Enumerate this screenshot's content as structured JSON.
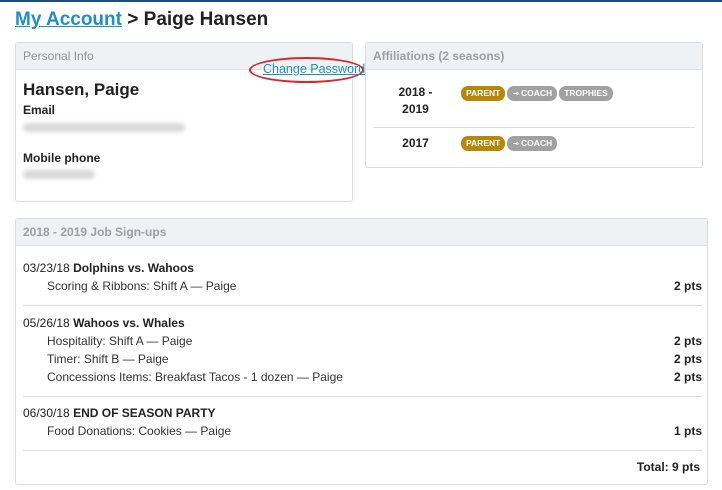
{
  "header": {
    "my_account_link": "My Account",
    "separator": ">",
    "person": "Paige Hansen"
  },
  "personal_info": {
    "heading": "Personal Info",
    "change_password_link": "Change Password",
    "name": "Hansen, Paige",
    "email_label": "Email",
    "mobile_label": "Mobile phone"
  },
  "affiliations": {
    "heading": "Affiliations (2 seasons)",
    "rows": [
      {
        "year_line1": "2018 -",
        "year_line2": "2019",
        "badges": [
          "PARENT",
          "COACH",
          "TROPHIES"
        ]
      },
      {
        "year_line1": "2017",
        "badges": [
          "PARENT",
          "COACH"
        ]
      }
    ],
    "key_icon": "key-icon",
    "colors": {
      "parent": "#b8860b",
      "other": "#a1a1a1"
    }
  },
  "jobs": {
    "heading": "2018 - 2019 Job Sign-ups",
    "groups": [
      {
        "date": "03/23/18",
        "title": "Dolphins vs. Wahoos",
        "items": [
          {
            "label": "Scoring & Ribbons: Shift A — Paige",
            "points": "2 pts"
          }
        ]
      },
      {
        "date": "05/26/18",
        "title": "Wahoos vs. Whales",
        "items": [
          {
            "label": "Hospitality: Shift A — Paige",
            "points": "2 pts"
          },
          {
            "label": "Timer: Shift B — Paige",
            "points": "2 pts"
          },
          {
            "label": "Concessions Items: Breakfast Tacos - 1 dozen — Paige",
            "points": "2 pts"
          }
        ]
      },
      {
        "date": "06/30/18",
        "title": "END OF SEASON PARTY",
        "items": [
          {
            "label": "Food Donations: Cookies — Paige",
            "points": "1 pts"
          }
        ]
      }
    ],
    "total": "Total: 9 pts"
  },
  "colors": {
    "link": "#1f8fc8",
    "highlight_ring": "#d9242a"
  }
}
